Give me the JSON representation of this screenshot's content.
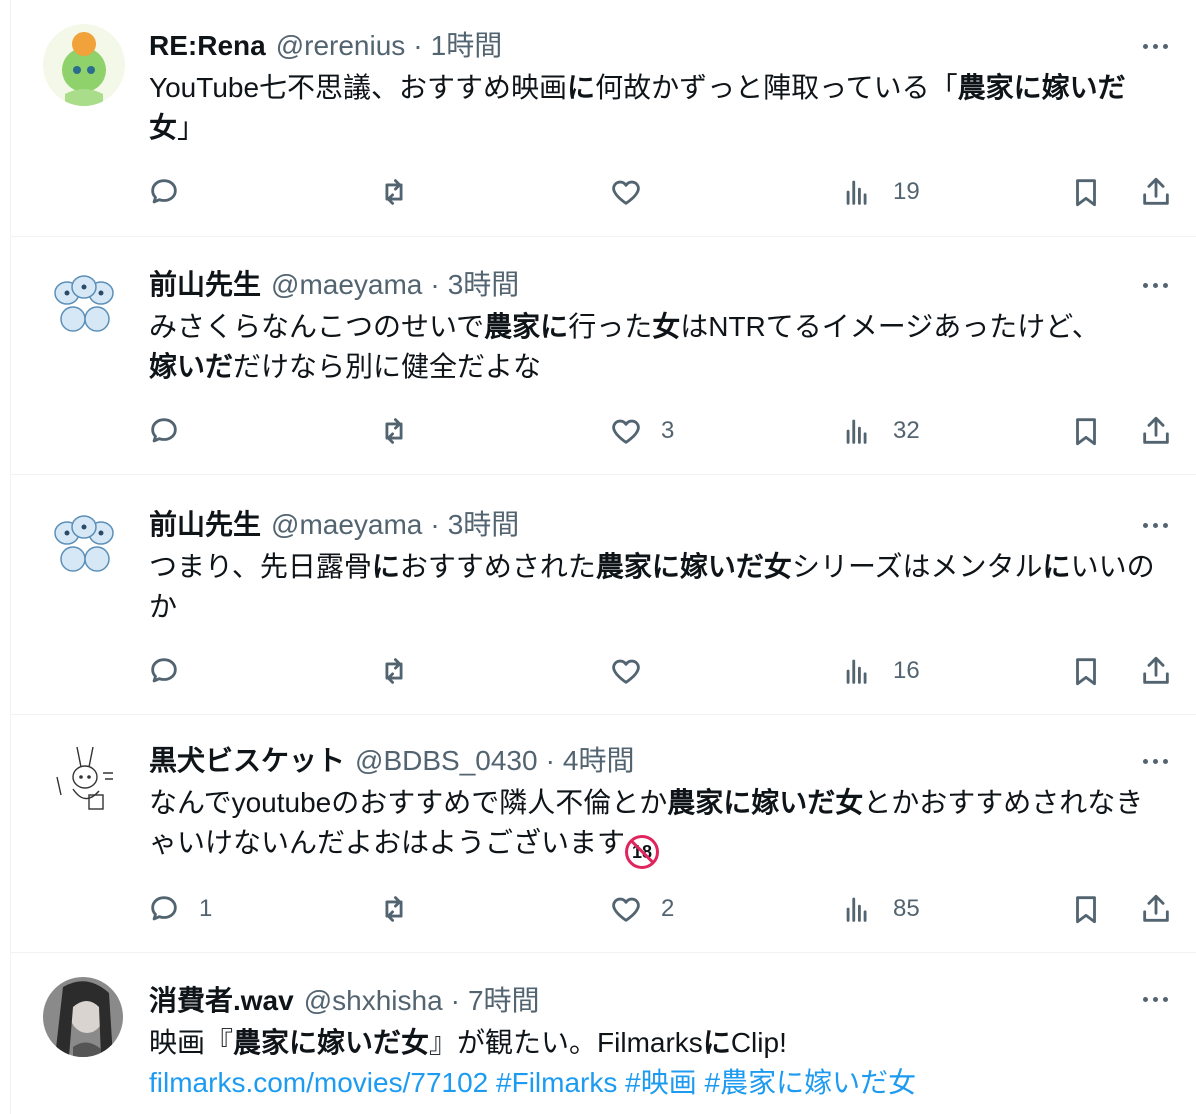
{
  "tweets": [
    {
      "name": "RE:Rena",
      "handle": "@rerenius",
      "time": "1時間",
      "avatar": "avatar-green-character",
      "text_parts": [
        "YouTube七不思議、おすすめ映画",
        "に",
        "何故かずっと陣取っている「",
        "農家に嫁いだ女",
        "」"
      ],
      "reply_count": "",
      "retweet_count": "",
      "like_count": "",
      "view_count": "19"
    },
    {
      "name": "前山先生",
      "handle": "@maeyama",
      "time": "3時間",
      "avatar": "avatar-blue-cats",
      "text_parts": [
        "みさくらなんこつのせいで",
        "農家に",
        "行った",
        "女",
        "はNTRてるイメージあったけど、",
        "嫁いだ",
        "だけなら別に健全だよな"
      ],
      "reply_count": "",
      "retweet_count": "",
      "like_count": "3",
      "view_count": "32"
    },
    {
      "name": "前山先生",
      "handle": "@maeyama",
      "time": "3時間",
      "avatar": "avatar-blue-cats",
      "text_parts": [
        "つまり、先日露骨",
        "に",
        "おすすめされた",
        "農家に嫁いだ女",
        "シリーズはメンタル",
        "に",
        "いいのか"
      ],
      "reply_count": "",
      "retweet_count": "",
      "like_count": "",
      "view_count": "16"
    },
    {
      "name": "黒犬ビスケット",
      "handle": "@BDBS_0430",
      "time": "4時間",
      "avatar": "avatar-sketch-rabbit",
      "text_parts": [
        "なんでyoutubeのおすすめで隣人不倫とか",
        "農家に嫁いだ女",
        "とかおすすめされなきゃいけないんだよおはようございます"
      ],
      "emoji": "18",
      "reply_count": "1",
      "retweet_count": "",
      "like_count": "2",
      "view_count": "85"
    },
    {
      "name": "消費者.wav",
      "handle": "@shxhisha",
      "time": "7時間",
      "avatar": "avatar-photo-person",
      "text_parts": [
        "映画『",
        "農家に嫁いだ女",
        "』が観たい。Filmarks",
        "に",
        "Clip!"
      ],
      "links": [
        "filmarks.com/movies/77102",
        "#Filmarks",
        "#映画",
        "#農家に嫁いだ女"
      ]
    }
  ],
  "icons": {
    "reply": "reply-icon",
    "retweet": "retweet-icon",
    "like": "heart-icon",
    "views": "views-icon",
    "bookmark": "bookmark-icon",
    "share": "share-icon",
    "more": "more-icon"
  },
  "colors": {
    "text": "#0f1419",
    "secondary": "#536471",
    "link": "#1d9bf0",
    "border": "#eff3f4"
  }
}
